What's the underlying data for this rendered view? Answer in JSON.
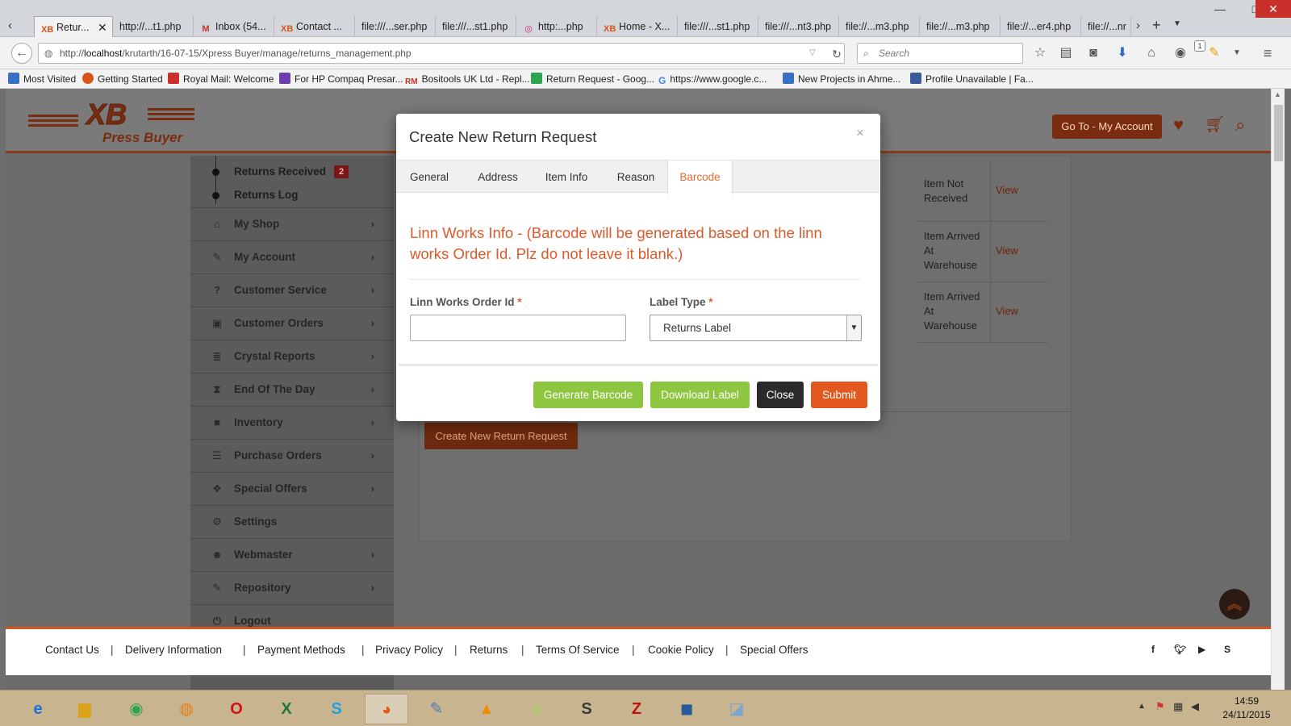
{
  "browser": {
    "tabs": [
      {
        "label": "Retur...",
        "icon": "xb-logo-icon",
        "active": true
      },
      {
        "label": "http://...t1.php"
      },
      {
        "label": "Inbox (54...",
        "icon": "gmail-icon"
      },
      {
        "label": "Contact ...",
        "icon": "xb-logo-icon"
      },
      {
        "label": "file:///...ser.php"
      },
      {
        "label": "file:///...st1.php"
      },
      {
        "label": "http:...php",
        "icon": "instagram-icon"
      },
      {
        "label": "Home - X...",
        "icon": "xb-logo-icon"
      },
      {
        "label": "file:///...st1.php"
      },
      {
        "label": "file:///...nt3.php"
      },
      {
        "label": "file://...m3.php"
      },
      {
        "label": "file://...m3.php"
      },
      {
        "label": "file://...er4.php"
      },
      {
        "label": "file://...nr"
      }
    ],
    "url_prefix": "http://",
    "url_host": "localhost",
    "url_path": "/krutarth/16-07-15/Xpress Buyer/manage/returns_management.php",
    "search_placeholder": "Search",
    "notification_count": "1",
    "bookmarks": [
      {
        "label": "Most Visited",
        "color": "#3b6fc4"
      },
      {
        "label": "Getting Started",
        "color": "#d9541a"
      },
      {
        "label": "Royal Mail: Welcome",
        "color": "#c9302c"
      },
      {
        "label": "For HP Compaq Presar...",
        "color": "#6a3db0"
      },
      {
        "label": "Bositools UK Ltd - Repl...",
        "color": "#c9302c"
      },
      {
        "label": "Return Request - Goog...",
        "color": "#2ea44f"
      },
      {
        "label": "https://www.google.c...",
        "color": "#4285f4"
      },
      {
        "label": "New Projects in Ahme...",
        "color": "#3b6fc4"
      },
      {
        "label": "Profile Unavailable | Fa...",
        "color": "#3b5998"
      }
    ]
  },
  "site": {
    "header": {
      "goto_account": "Go To - My Account"
    },
    "sidebar": {
      "sub_items": [
        {
          "label": "Returns Received",
          "badge": "2"
        },
        {
          "label": "Returns Log"
        }
      ],
      "menu": [
        {
          "label": "My Shop",
          "icon": "home-icon",
          "chevron": true
        },
        {
          "label": "My Account",
          "icon": "pencil-icon",
          "chevron": true
        },
        {
          "label": "Customer Service",
          "icon": "question-icon",
          "chevron": true
        },
        {
          "label": "Customer Orders",
          "icon": "money-icon",
          "chevron": true
        },
        {
          "label": "Crystal Reports",
          "icon": "database-icon",
          "chevron": true
        },
        {
          "label": "End Of The Day",
          "icon": "hourglass-icon",
          "chevron": true
        },
        {
          "label": "Inventory",
          "icon": "briefcase-icon",
          "chevron": true
        },
        {
          "label": "Purchase Orders",
          "icon": "list-icon",
          "chevron": true
        },
        {
          "label": "Special Offers",
          "icon": "gift-icon",
          "chevron": true
        },
        {
          "label": "Settings",
          "icon": "cogs-icon",
          "chevron": false
        },
        {
          "label": "Webmaster",
          "icon": "user-cog-icon",
          "chevron": true
        },
        {
          "label": "Repository",
          "icon": "pencil-icon",
          "chevron": true
        },
        {
          "label": "Logout",
          "icon": "power-icon",
          "chevron": false
        }
      ]
    },
    "returns_table": [
      {
        "status": "Item Not Received",
        "action": "View"
      },
      {
        "status": "Item Arrived At Warehouse",
        "action": "View"
      },
      {
        "status": "Item Arrived At Warehouse",
        "action": "View"
      }
    ],
    "create_button": "Create New Return Request",
    "footer": {
      "links": [
        "Contact Us",
        "Delivery Information",
        "Payment Methods",
        "Privacy Policy",
        "Returns",
        "Terms Of Service",
        "Cookie Policy",
        "Special Offers"
      ],
      "social": [
        "facebook-icon",
        "twitter-icon",
        "youtube-icon",
        "skype-icon"
      ]
    }
  },
  "modal": {
    "title": "Create New Return Request",
    "close_symbol": "×",
    "tabs": [
      "General",
      "Address",
      "Item Info",
      "Reason",
      "Barcode"
    ],
    "active_tab": "Barcode",
    "info_text": "Linn Works Info - (Barcode will be generated based on the linn works Order Id. Plz do not leave it blank.)",
    "order_id_label": "Linn Works Order Id",
    "order_id_value": "",
    "label_type_label": "Label Type",
    "label_type_value": "Returns Label",
    "required_mark": "*",
    "buttons": {
      "generate": "Generate Barcode",
      "download": "Download Label",
      "close": "Close",
      "submit": "Submit"
    },
    "colors": {
      "accent": "#e0582a",
      "green": "#8dc63f",
      "dark": "#2b2b2b",
      "submit": "#e2581f"
    }
  },
  "taskbar": {
    "apps": [
      "internet-explorer-icon",
      "file-explorer-icon",
      "chrome-icon",
      "ubuntu-one-icon",
      "opera-icon",
      "excel-icon",
      "skype-icon",
      "firefox-icon",
      "paint-icon",
      "vlc-icon",
      "files-icon",
      "sublime-icon",
      "filezilla-icon",
      "virtualbox-icon",
      "notes-icon"
    ],
    "time": "14:59",
    "date": "24/11/2015"
  }
}
